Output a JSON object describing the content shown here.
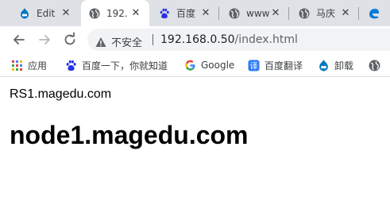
{
  "tabs": [
    {
      "label": "Edit",
      "icon": "drupal-icon",
      "active": false
    },
    {
      "label": "192.",
      "icon": "globe-icon",
      "active": true
    },
    {
      "label": "百度",
      "icon": "baidu-paw-icon",
      "active": false
    },
    {
      "label": "www",
      "icon": "globe-icon",
      "active": false
    },
    {
      "label": "马庆",
      "icon": "globe-icon",
      "active": false
    },
    {
      "label": "",
      "icon": "edge-icon",
      "active": false
    }
  ],
  "toolbar": {
    "security_label": "不安全",
    "url_host": "192.168.0.50",
    "url_path": "/index.html"
  },
  "bookmarks": [
    {
      "label": "应用",
      "icon": "apps-grid-icon"
    },
    {
      "label": "百度一下，你就知道",
      "icon": "baidu-paw-icon"
    },
    {
      "label": "Google",
      "icon": "google-icon"
    },
    {
      "label": "百度翻译",
      "icon": "baidu-translate-icon"
    },
    {
      "label": "卸载",
      "icon": "drupal-icon"
    },
    {
      "label": "",
      "icon": "globe-icon"
    }
  ],
  "page": {
    "line1": "RS1.magedu.com",
    "heading": "node1.magedu.com"
  },
  "colors": {
    "tabstrip": "#dee1e6",
    "omnibox": "#f1f3f4",
    "baidu_blue": "#2932e1",
    "drupal_blue": "#0077c0"
  }
}
